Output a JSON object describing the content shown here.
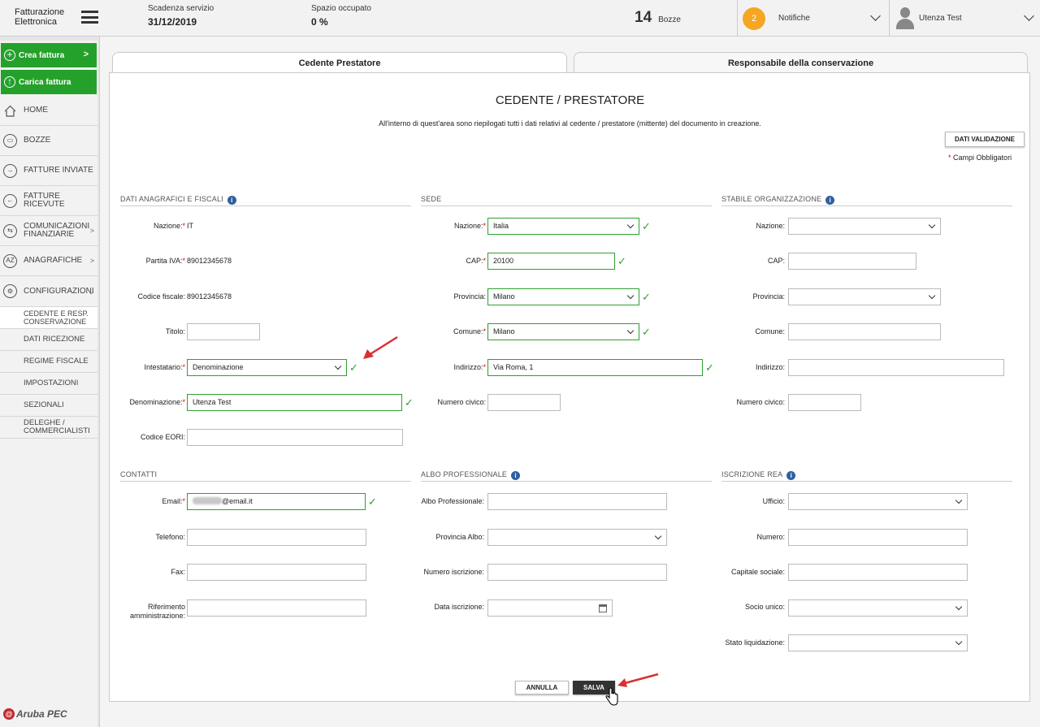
{
  "header": {
    "app_title_line1": "Fatturazione",
    "app_title_line2": "Elettronica",
    "scadenza_label": "Scadenza servizio",
    "scadenza_value": "31/12/2019",
    "spazio_label": "Spazio occupato",
    "spazio_value": "0 %",
    "bozze_count": "14",
    "bozze_label": "Bozze",
    "notifiche_count": "2",
    "notifiche_label": "Notifiche",
    "user_name": "Utenza Test"
  },
  "sidebar": {
    "crea": "Crea fattura",
    "carica": "Carica fattura",
    "items": [
      "HOME",
      "BOZZE",
      "FATTURE INVIATE",
      "FATTURE RICEVUTE",
      "COMUNICAZIONI FINANZIARIE",
      "ANAGRAFICHE",
      "CONFIGURAZIONI"
    ],
    "sub_items": [
      "CEDENTE E RESP. CONSERVAZIONE",
      "DATI RICEZIONE",
      "REGIME FISCALE",
      "IMPOSTAZIONI",
      "SEZIONALI",
      "DELEGHE / COMMERCIALISTI"
    ],
    "logo": "Aruba PEC"
  },
  "tabs": [
    "Cedente Prestatore",
    "Responsabile della conservazione"
  ],
  "page": {
    "title": "CEDENTE / PRESTATORE",
    "description": "All'interno di quest'area sono riepilogati tutti i dati relativi al cedente / prestatore (mittente) del documento in creazione.",
    "dati_validazione": "DATI VALIDAZIONE",
    "required_note": "Campi Obbligatori",
    "required_mark": "*"
  },
  "sections": {
    "anagrafici": "DATI ANAGRAFICI E FISCALI",
    "sede": "SEDE",
    "stabile": "STABILE ORGANIZZAZIONE",
    "contatti": "CONTATTI",
    "albo": "ALBO PROFESSIONALE",
    "rea": "ISCRIZIONE REA"
  },
  "anagrafici": {
    "nazione_label": "Nazione:",
    "nazione_value": "IT",
    "piva_label": "Partita IVA:",
    "piva_value": "89012345678",
    "cf_label": "Codice fiscale:",
    "cf_value": "89012345678",
    "titolo_label": "Titolo:",
    "titolo_value": "",
    "intestatario_label": "Intestatario:",
    "intestatario_value": "Denominazione",
    "denominazione_label": "Denominazione:",
    "denominazione_value": "Utenza Test",
    "eori_label": "Codice EORI:",
    "eori_value": ""
  },
  "sede": {
    "nazione_label": "Nazione:",
    "nazione_value": "Italia",
    "cap_label": "CAP:",
    "cap_value": "20100",
    "provincia_label": "Provincia:",
    "provincia_value": "Milano",
    "comune_label": "Comune:",
    "comune_value": "Milano",
    "indirizzo_label": "Indirizzo:",
    "indirizzo_value": "Via Roma, 1",
    "civico_label": "Numero civico:",
    "civico_value": ""
  },
  "stabile": {
    "nazione_label": "Nazione:",
    "cap_label": "CAP:",
    "provincia_label": "Provincia:",
    "comune_label": "Comune:",
    "indirizzo_label": "Indirizzo:",
    "civico_label": "Numero civico:"
  },
  "contatti": {
    "email_label": "Email:",
    "email_value": "@email.it",
    "telefono_label": "Telefono:",
    "fax_label": "Fax:",
    "rif_label_1": "Riferimento",
    "rif_label_2": "amministrazione:"
  },
  "albo": {
    "albo_label": "Albo Professionale:",
    "provincia_label": "Provincia Albo:",
    "numero_label": "Numero iscrizione:",
    "data_label": "Data iscrizione:"
  },
  "rea": {
    "ufficio_label": "Ufficio:",
    "numero_label": "Numero:",
    "capitale_label": "Capitale sociale:",
    "socio_label": "Socio unico:",
    "stato_label": "Stato liquidazione:"
  },
  "buttons": {
    "annulla": "ANNULLA",
    "salva": "SALVA"
  },
  "colors": {
    "accent_green": "#24a12b",
    "valid_green": "#2fa02f",
    "notif_orange": "#f5a623",
    "annotation_red": "#d8312f"
  }
}
